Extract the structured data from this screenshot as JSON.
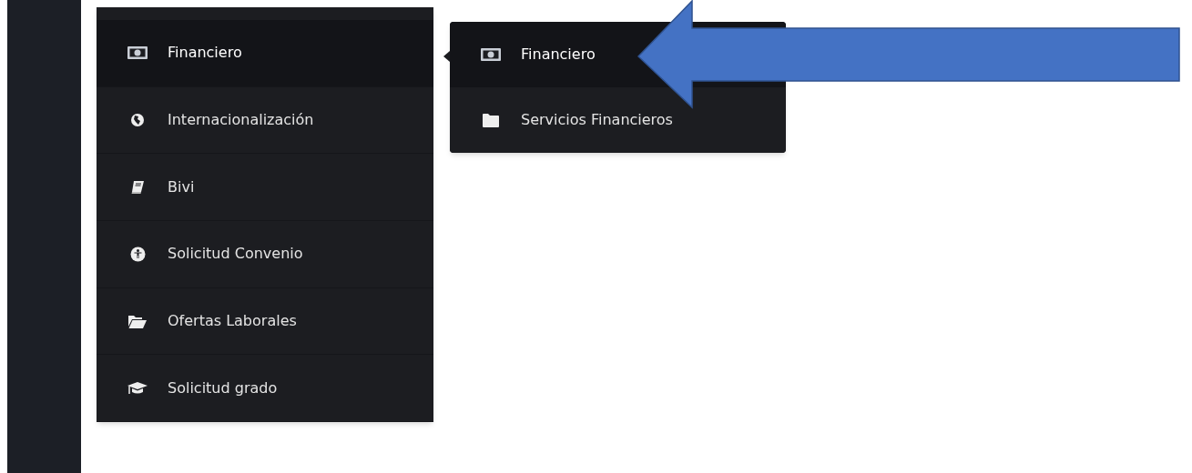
{
  "menu": {
    "items": [
      {
        "label": "Financiero",
        "selected": true
      },
      {
        "label": "Internacionalización",
        "selected": false
      },
      {
        "label": "Bivi",
        "selected": false
      },
      {
        "label": "Solicitud Convenio",
        "selected": false
      },
      {
        "label": "Ofertas Laborales",
        "selected": false
      },
      {
        "label": "Solicitud grado",
        "selected": false
      }
    ]
  },
  "submenu": {
    "items": [
      {
        "label": "Financiero",
        "selected": true
      },
      {
        "label": "Servicios Financieros",
        "selected": false
      }
    ]
  }
}
